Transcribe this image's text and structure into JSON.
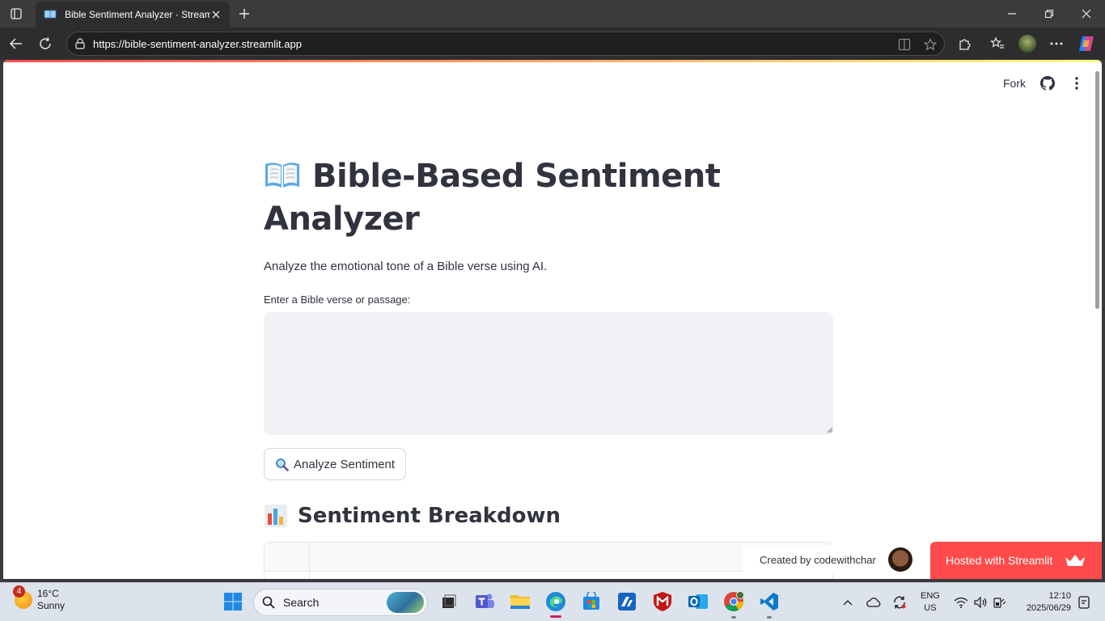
{
  "browser": {
    "tab_title": "Bible Sentiment Analyzer · Streamlit",
    "url": "https://bible-sentiment-analyzer.streamlit.app",
    "icons": [
      "tab-actions-icon",
      "close-icon",
      "new-tab-icon",
      "minimize-icon",
      "restore-icon",
      "window-close-icon",
      "back-icon",
      "refresh-icon",
      "site-info-icon",
      "split-screen-icon",
      "favorite-star-icon",
      "extensions-icon",
      "favorites-icon",
      "profile-avatar",
      "more-icon",
      "copilot-icon"
    ]
  },
  "streamlit_toolbar": {
    "fork_label": "Fork",
    "icons": [
      "github-icon",
      "kebab-menu-icon"
    ]
  },
  "app": {
    "title_emoji": "open-book",
    "title": "Bible-Based Sentiment Analyzer",
    "subtitle": "Analyze the emotional tone of a Bible verse using AI.",
    "input_label": "Enter a Bible verse or passage:",
    "input_value": "",
    "analyze_button": "Analyze Sentiment",
    "analyze_emoji": "magnifying-glass",
    "section_emoji": "bar-chart",
    "section_title": "Sentiment Breakdown"
  },
  "footer": {
    "created_by": "Created by codewithchar",
    "hosted": "Hosted with Streamlit"
  },
  "taskbar": {
    "weather_badge": "4",
    "temperature": "16°C",
    "condition": "Sunny",
    "search_placeholder": "Search",
    "lang_line1": "ENG",
    "lang_line2": "US",
    "time": "12:10",
    "date": "2025/06/29",
    "apps": [
      "windows-start",
      "task-view",
      "teams",
      "file-explorer",
      "edge",
      "microsoft-store",
      "app-icon",
      "mcafee",
      "outlook",
      "chrome",
      "vscode"
    ]
  },
  "colors": {
    "streamlit_red": "#ff4b4b",
    "text": "#31333f",
    "input_bg": "#f0f2f6"
  }
}
